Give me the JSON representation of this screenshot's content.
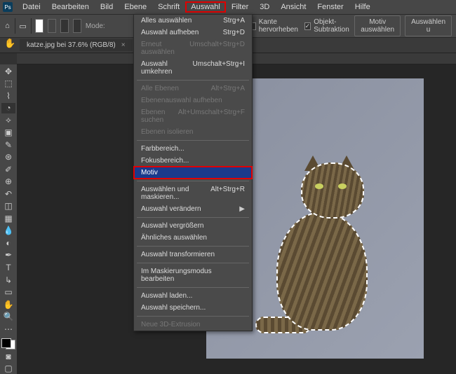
{
  "menubar": [
    "Datei",
    "Bearbeiten",
    "Bild",
    "Ebene",
    "Schrift",
    "Auswahl",
    "Filter",
    "3D",
    "Ansicht",
    "Fenster",
    "Hilfe"
  ],
  "menubar_open": "Auswahl",
  "toolbar": {
    "mode_label": "Mode:",
    "edge_checkbox": "Kante hervorheben",
    "subtract_checkbox": "Objekt-Subtraktion",
    "select_subject_btn": "Motiv auswählen",
    "select_mask_btn": "Auswählen u"
  },
  "tab": {
    "title": "katze.jpg bei 37.6% (RGB/8)"
  },
  "dropdown": {
    "groups": [
      [
        {
          "label": "Alles auswählen",
          "shortcut": "Strg+A",
          "disabled": false
        },
        {
          "label": "Auswahl aufheben",
          "shortcut": "Strg+D",
          "disabled": false
        },
        {
          "label": "Erneut auswählen",
          "shortcut": "Umschalt+Strg+D",
          "disabled": true
        },
        {
          "label": "Auswahl umkehren",
          "shortcut": "Umschalt+Strg+I",
          "disabled": false
        }
      ],
      [
        {
          "label": "Alle Ebenen",
          "shortcut": "Alt+Strg+A",
          "disabled": true
        },
        {
          "label": "Ebenenauswahl aufheben",
          "shortcut": "",
          "disabled": true
        },
        {
          "label": "Ebenen suchen",
          "shortcut": "Alt+Umschalt+Strg+F",
          "disabled": true
        },
        {
          "label": "Ebenen isolieren",
          "shortcut": "",
          "disabled": true
        }
      ],
      [
        {
          "label": "Farbbereich...",
          "shortcut": "",
          "disabled": false
        },
        {
          "label": "Fokusbereich...",
          "shortcut": "",
          "disabled": false
        },
        {
          "label": "Motiv",
          "shortcut": "",
          "disabled": false,
          "highlight": true,
          "boxed": true
        }
      ],
      [
        {
          "label": "Auswählen und maskieren...",
          "shortcut": "Alt+Strg+R",
          "disabled": false
        },
        {
          "label": "Auswahl verändern",
          "shortcut": "",
          "disabled": false,
          "submenu": true
        }
      ],
      [
        {
          "label": "Auswahl vergrößern",
          "shortcut": "",
          "disabled": false
        },
        {
          "label": "Ähnliches auswählen",
          "shortcut": "",
          "disabled": false
        }
      ],
      [
        {
          "label": "Auswahl transformieren",
          "shortcut": "",
          "disabled": false
        }
      ],
      [
        {
          "label": "Im Maskierungsmodus bearbeiten",
          "shortcut": "",
          "disabled": false
        }
      ],
      [
        {
          "label": "Auswahl laden...",
          "shortcut": "",
          "disabled": false
        },
        {
          "label": "Auswahl speichern...",
          "shortcut": "",
          "disabled": false
        }
      ],
      [
        {
          "label": "Neue 3D-Extrusion",
          "shortcut": "",
          "disabled": true
        }
      ]
    ]
  }
}
